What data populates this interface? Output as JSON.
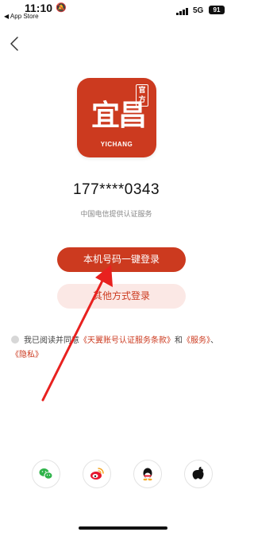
{
  "status_bar": {
    "time": "11:10",
    "back_to_app": "◀ App Store",
    "network": "5G",
    "battery": "91"
  },
  "logo": {
    "main_text": "宜昌",
    "stamp_text": "官方",
    "english_text": "YICHANG",
    "color": "#cc3a1f"
  },
  "phone_number": "177****0343",
  "provider_text": "中国电信提供认证服务",
  "buttons": {
    "one_click_login": "本机号码一键登录",
    "other_login": "其他方式登录"
  },
  "agreement": {
    "prefix": "我已阅读并同意",
    "link1": "《天翼账号认证服务条款》",
    "joiner": "和",
    "link2": "《服务》",
    "separator": "、",
    "link3": "《隐私》"
  },
  "social_logins": [
    "wechat-icon",
    "weibo-icon",
    "qq-icon",
    "apple-icon"
  ],
  "colors": {
    "accent": "#cc3a1f",
    "accent_light": "#fbe8e5",
    "wechat": "#2fb34a",
    "weibo": "#e6162d",
    "annotation_arrow": "#e8211f"
  }
}
